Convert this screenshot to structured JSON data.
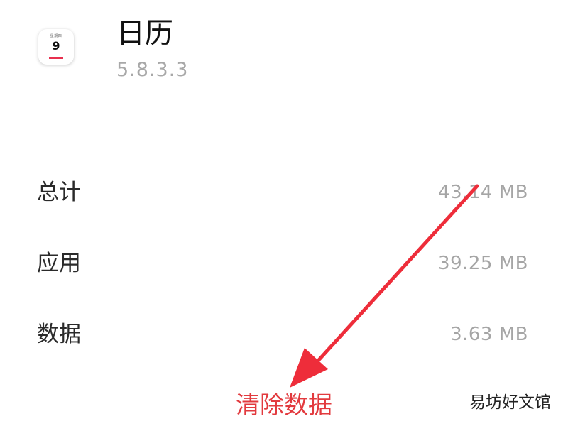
{
  "app": {
    "icon_weekday": "星期四",
    "icon_day": "9",
    "name": "日历",
    "version": "5.8.3.3"
  },
  "storage": {
    "rows": [
      {
        "label": "总计",
        "value": "43.14 MB"
      },
      {
        "label": "应用",
        "value": "39.25 MB"
      },
      {
        "label": "数据",
        "value": "3.63 MB"
      }
    ]
  },
  "actions": {
    "clear_data_label": "清除数据"
  },
  "annotation": {
    "arrow_color": "#ee2d3a"
  },
  "watermark": "易坊好文馆"
}
